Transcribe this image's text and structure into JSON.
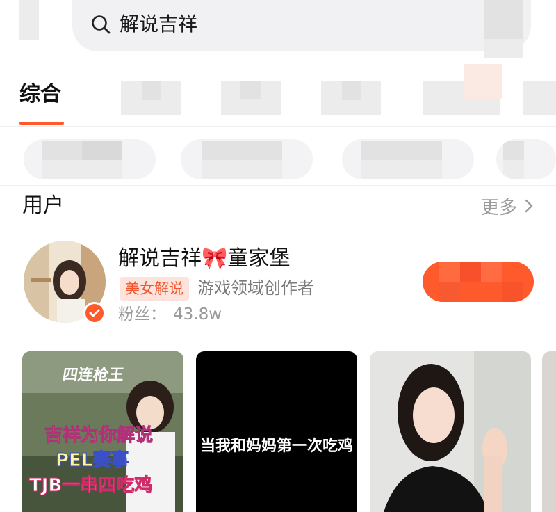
{
  "search": {
    "query": "解说吉祥"
  },
  "tabs": {
    "active_label": "综合"
  },
  "users_section": {
    "title": "用户",
    "more_label": "更多"
  },
  "user": {
    "name": "解说吉祥🎀童家堡",
    "tag": "美女解说",
    "description": "游戏领域创作者",
    "fans_label": "粉丝：",
    "fans_count": "43.8w"
  },
  "videos": [
    {
      "thumb_title": "四连枪王",
      "thumb_lines": [
        "吉祥为你解说",
        "PEL赛事",
        "TJB一串四吃鸡"
      ]
    },
    {
      "caption": "当我和妈妈第一次吃鸡"
    },
    {}
  ],
  "colors": {
    "accent": "#ff5a2b",
    "tag_bg": "#fde3dc"
  }
}
